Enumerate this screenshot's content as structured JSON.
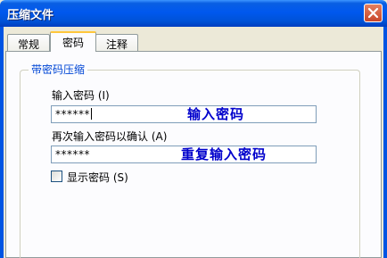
{
  "window": {
    "title": "压缩文件"
  },
  "tabs": [
    {
      "label": "常规",
      "active": false
    },
    {
      "label": "密码",
      "active": true
    },
    {
      "label": "注释",
      "active": false
    }
  ],
  "group": {
    "label": "带密码压缩"
  },
  "password": {
    "label": "输入密码 (I)",
    "value": "******",
    "annotation": "输入密码"
  },
  "confirm": {
    "label": "再次输入密码以确认 (A)",
    "value": "******",
    "annotation": "重复输入密码"
  },
  "show_password": {
    "label": "显示密码 (S)",
    "checked": false
  },
  "colors": {
    "annotation": "#0000cc",
    "title_bar": "#0054e3",
    "accent_tab": "#ffc73c"
  }
}
